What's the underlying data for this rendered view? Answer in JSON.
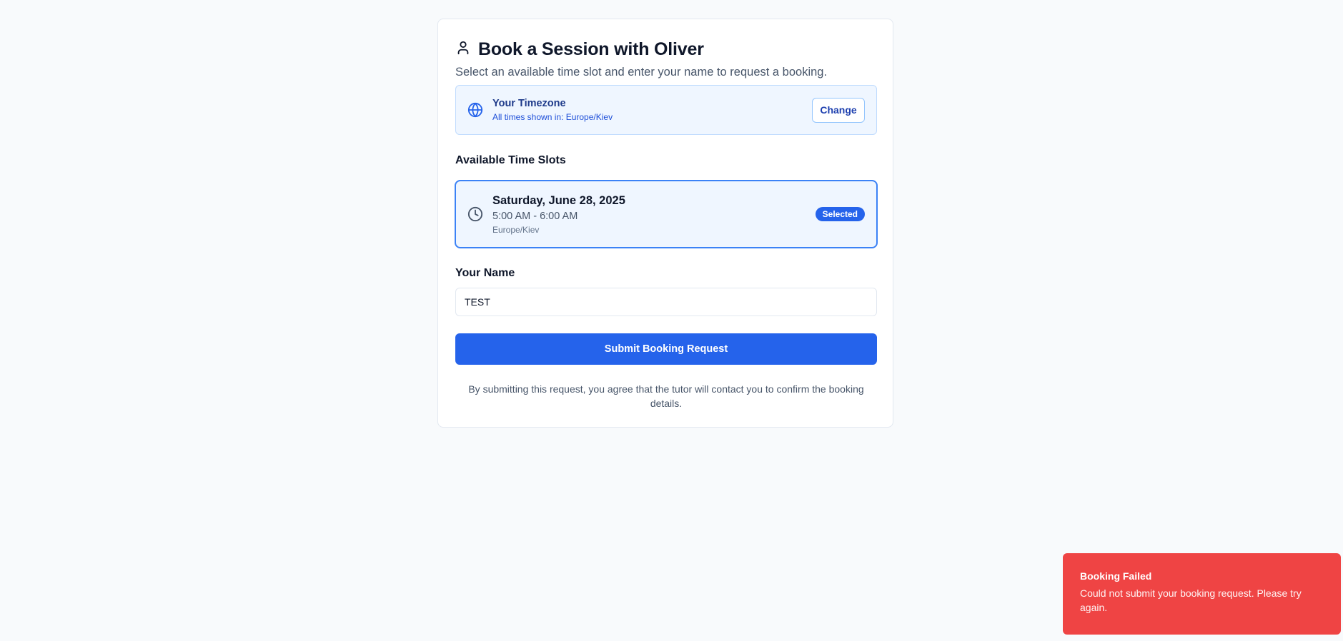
{
  "header": {
    "title": "Book a Session with Oliver",
    "subtitle": "Select an available time slot and enter your name to request a booking.",
    "icon": "user-icon"
  },
  "timezone": {
    "title": "Your Timezone",
    "subtitle": "All times shown in: Europe/Kiev",
    "change_label": "Change",
    "icon": "globe-icon"
  },
  "slots": {
    "section_label": "Available Time Slots",
    "items": [
      {
        "date": "Saturday, June 28, 2025",
        "time": "5:00 AM - 6:00 AM",
        "timezone": "Europe/Kiev",
        "badge": "Selected",
        "icon": "clock-icon"
      }
    ]
  },
  "form": {
    "name_label": "Your Name",
    "name_value": "TEST",
    "submit_label": "Submit Booking Request",
    "disclaimer": "By submitting this request, you agree that the tutor will contact you to confirm the booking details."
  },
  "toast": {
    "title": "Booking Failed",
    "message": "Could not submit your booking request. Please try again."
  },
  "colors": {
    "primary": "#2563eb",
    "error": "#ef4444",
    "background": "#f8fafc",
    "info_bg": "#eff6ff"
  }
}
